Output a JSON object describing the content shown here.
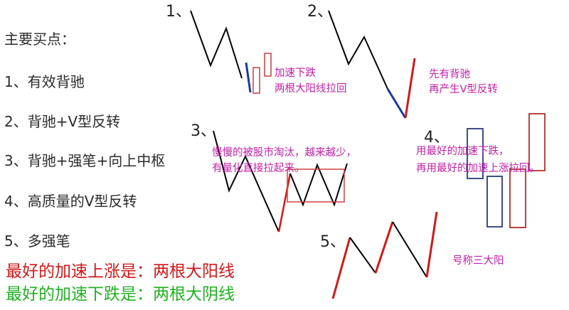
{
  "colors": {
    "text": "#2b2b2b",
    "magenta": "#c020a8",
    "red": "#d01818",
    "green": "#22b022",
    "blue": "#1a3aa0",
    "line": "#000000",
    "bull_box": "#c04040",
    "bear_box": "#2a3a7a"
  },
  "title": "主要买点：",
  "points": [
    "1、有效背驰",
    "2、背驰+V型反转",
    "3、背驰+强笔+向上中枢",
    "4、高质量的V型反转",
    "5、多强笔"
  ],
  "best_rise": "最好的加速上涨是：两根大阳线",
  "best_fall": "最好的加速下跌是：两根大阴线",
  "diagrams": {
    "d1": {
      "label": "1、",
      "note_line1": "加速下跌",
      "note_line2": "两根大阳线拉回"
    },
    "d2": {
      "label": "2、",
      "note_line1": "先有背驰",
      "note_line2": "再产生V型反转"
    },
    "d3": {
      "label": "3、",
      "note_line1": "慢慢的被股市淘汰，越来越少，",
      "note_line2": "有量化直接拉起来。"
    },
    "d4": {
      "label": "4、",
      "note_line1": "用最好的加速下跌，",
      "note_line2": "再用最好的加速上涨拉回。"
    },
    "d5": {
      "label": "5、",
      "note": "号称三大阳"
    }
  }
}
